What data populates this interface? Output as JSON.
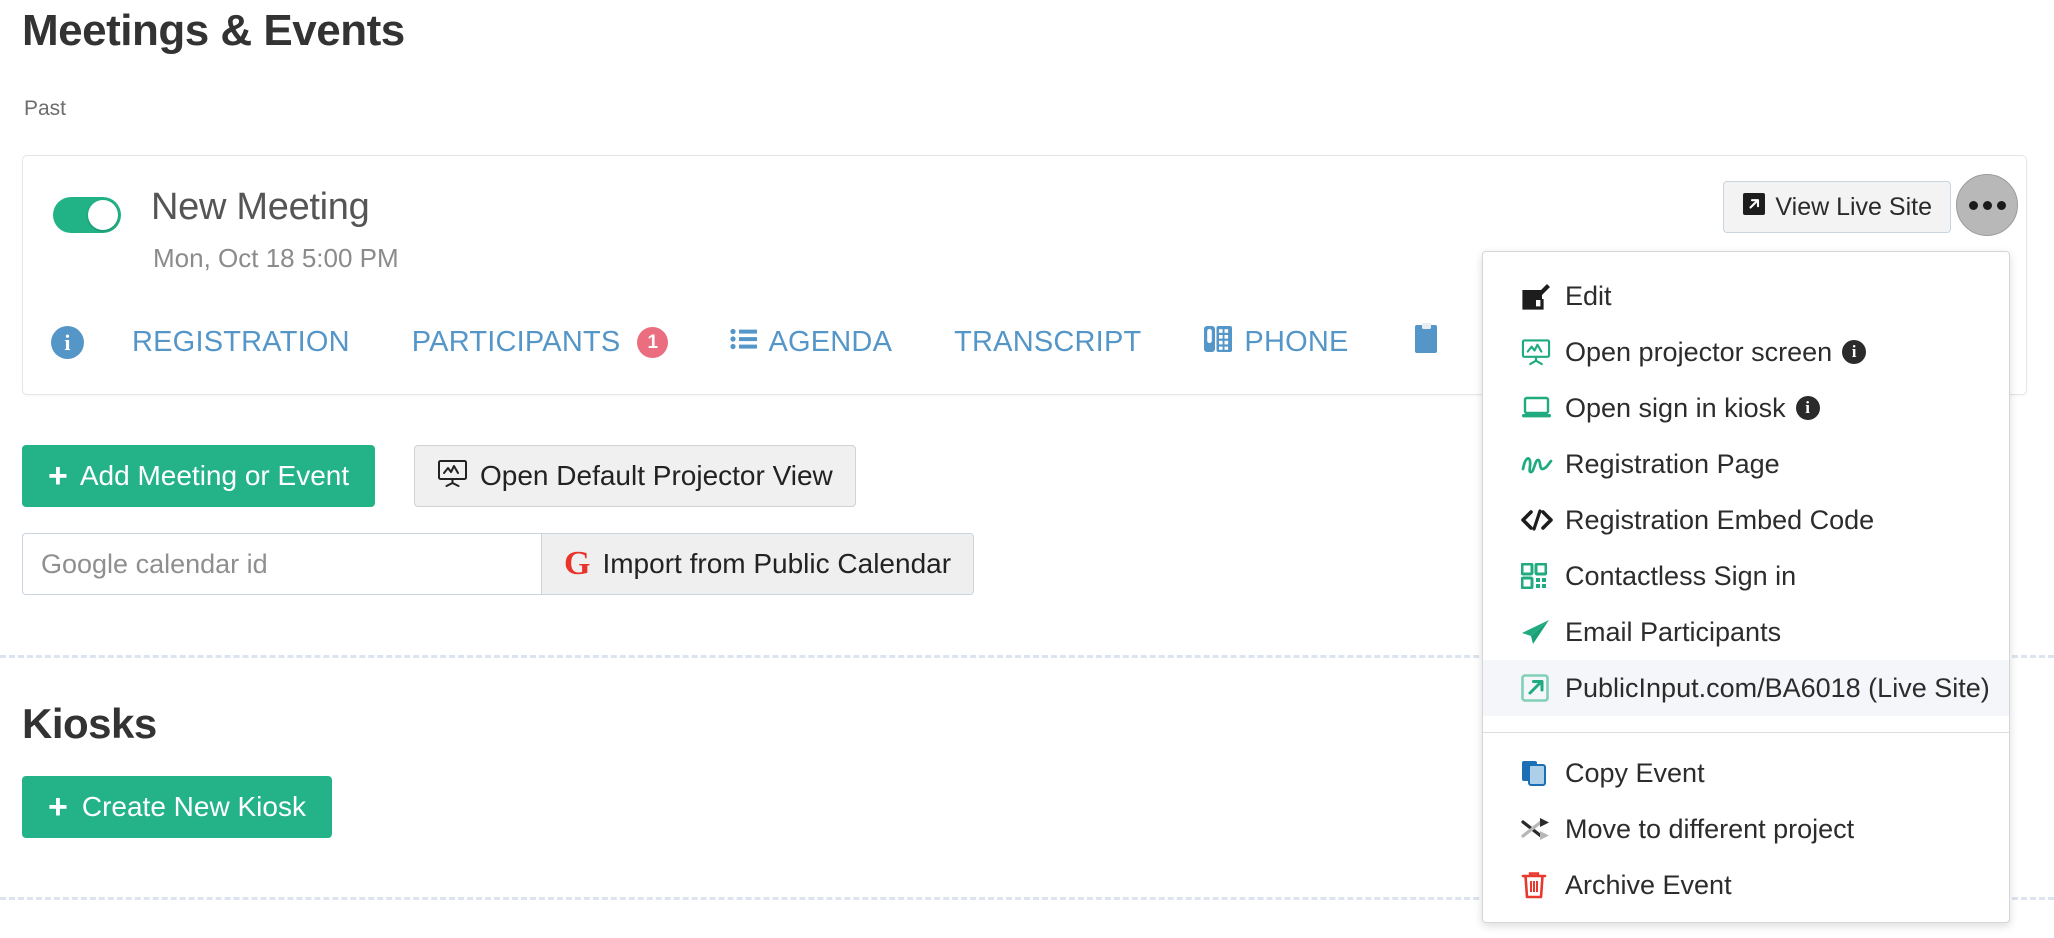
{
  "header": {
    "title": "Meetings & Events",
    "subtitle": "Past"
  },
  "meeting_card": {
    "toggle_state": "on",
    "title": "New Meeting",
    "date": "Mon, Oct 18 5:00 PM",
    "live_site_button": "View Live Site",
    "live_site_icon": "external-link-icon",
    "kebab_icon": "ellipsis-icon",
    "tabs": [
      {
        "label": "",
        "icon": "info-circle-icon",
        "badge": ""
      },
      {
        "label": "REGISTRATION",
        "icon": "",
        "badge": ""
      },
      {
        "label": "PARTICIPANTS",
        "icon": "",
        "badge": "1"
      },
      {
        "label": "AGENDA",
        "icon": "list-icon",
        "badge": ""
      },
      {
        "label": "TRANSCRIPT",
        "icon": "",
        "badge": ""
      },
      {
        "label": "PHONE",
        "icon": "phone-keypad-icon",
        "badge": ""
      }
    ]
  },
  "actions": {
    "add_meeting": "Add Meeting or Event",
    "add_meeting_icon": "plus-icon",
    "open_projector": "Open Default Projector View",
    "open_projector_icon": "projector-screen-icon"
  },
  "calendar": {
    "placeholder": "Google calendar id",
    "value": "",
    "import_button": "Import from Public Calendar",
    "import_icon": "google-g-icon"
  },
  "kiosks": {
    "title": "Kiosks",
    "create_button": "Create New Kiosk",
    "create_icon": "plus-icon"
  },
  "dropdown": {
    "items": [
      {
        "label": "Edit",
        "icon": "edit-pencil-icon",
        "info": false,
        "active": false
      },
      {
        "label": "Open projector screen",
        "icon": "projector-screen-icon",
        "info": true,
        "active": false
      },
      {
        "label": "Open sign in kiosk",
        "icon": "laptop-icon",
        "info": true,
        "active": false
      },
      {
        "label": "Registration Page",
        "icon": "signature-icon",
        "info": false,
        "active": false
      },
      {
        "label": "Registration Embed Code",
        "icon": "code-icon",
        "info": false,
        "active": false
      },
      {
        "label": "Contactless Sign in",
        "icon": "qr-code-icon",
        "info": false,
        "active": false
      },
      {
        "label": "Email Participants",
        "icon": "paper-plane-icon",
        "info": false,
        "active": false
      },
      {
        "label": "PublicInput.com/BA6018 (Live Site)",
        "icon": "external-link-icon",
        "info": false,
        "active": true
      }
    ],
    "items_lower": [
      {
        "label": "Copy Event",
        "icon": "copy-icon",
        "info": false,
        "active": false
      },
      {
        "label": "Move to different project",
        "icon": "shuffle-arrows-icon",
        "info": false,
        "active": false
      },
      {
        "label": "Archive Event",
        "icon": "trash-icon",
        "info": false,
        "active": false
      }
    ],
    "info_badge_char": "i"
  },
  "colors": {
    "brand_green": "#24b289",
    "tab_blue": "#5596c8",
    "badge_red": "#ea6e80",
    "menu_icon_green": "#1fab7f",
    "archive_red": "#e8392f",
    "copy_blue": "#1d6fb5"
  }
}
